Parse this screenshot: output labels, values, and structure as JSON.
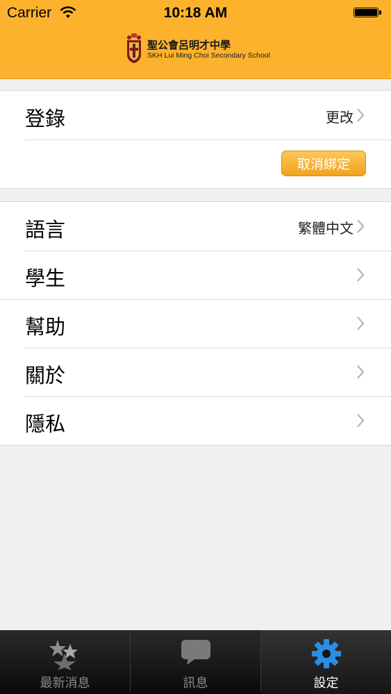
{
  "status_bar": {
    "carrier": "Carrier",
    "time": "10:18 AM"
  },
  "header": {
    "school_name_zh": "聖公會呂明才中學",
    "school_name_en": "SKH Lui Ming Choi Secondary School"
  },
  "account": {
    "login_label": "登錄",
    "login_value": "更改",
    "unbind_label": "取消綁定"
  },
  "settings": {
    "items": [
      {
        "label": "語言",
        "value": "繁體中文"
      },
      {
        "label": "學生",
        "value": ""
      },
      {
        "label": "幫助",
        "value": ""
      },
      {
        "label": "關於",
        "value": ""
      },
      {
        "label": "隱私",
        "value": ""
      }
    ]
  },
  "tabbar": {
    "tabs": [
      {
        "label": "最新消息",
        "icon": "stars-icon"
      },
      {
        "label": "訊息",
        "icon": "chat-bubble-icon"
      },
      {
        "label": "設定",
        "icon": "gear-icon"
      }
    ],
    "active_index": 2
  },
  "colors": {
    "header": "#fdb22d",
    "button": "#f2a21e",
    "gear_active": "#2a8ee6",
    "tabbar": "#111111"
  }
}
